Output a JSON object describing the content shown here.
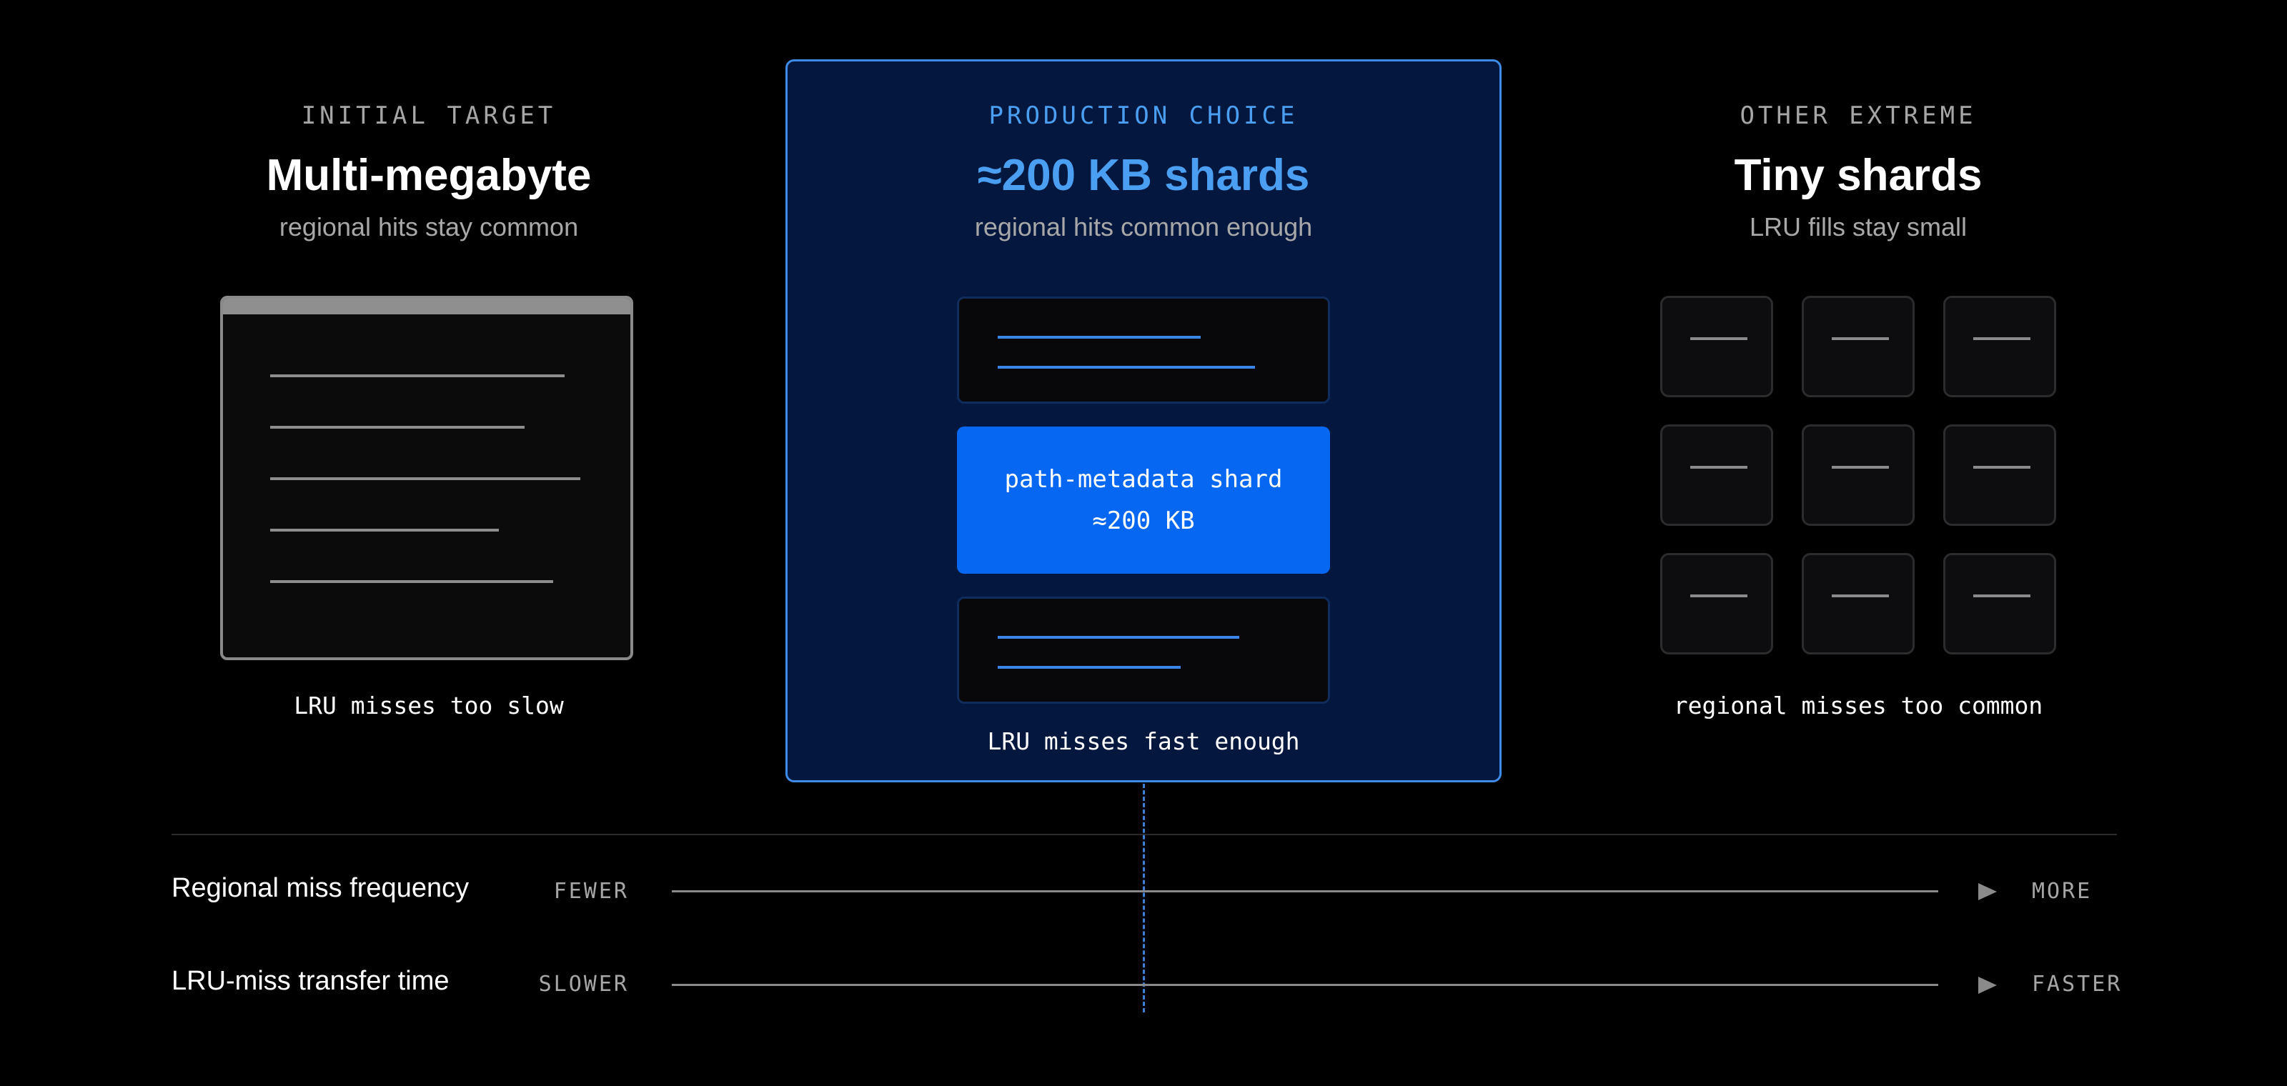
{
  "columns": {
    "left": {
      "kicker": "INITIAL TARGET",
      "title": "Multi-megabyte",
      "subtitle": "regional hits stay common",
      "caption": "LRU misses too slow"
    },
    "center": {
      "kicker": "PRODUCTION CHOICE",
      "title": "≈200 KB shards",
      "subtitle": "regional hits common enough",
      "highlight_line1": "path-metadata shard",
      "highlight_line2": "≈200 KB",
      "caption": "LRU misses fast enough"
    },
    "right": {
      "kicker": "OTHER EXTREME",
      "title": "Tiny shards",
      "subtitle": "LRU fills stay small",
      "caption": "regional misses too common"
    }
  },
  "axes": [
    {
      "label": "Regional miss frequency",
      "start": "FEWER",
      "end": "MORE"
    },
    {
      "label": "LRU-miss transfer time",
      "start": "SLOWER",
      "end": "FASTER"
    }
  ],
  "colors": {
    "background": "#000000",
    "accent": "#4a9ff2",
    "panel": "#04173e",
    "highlight": "#0668f2"
  }
}
